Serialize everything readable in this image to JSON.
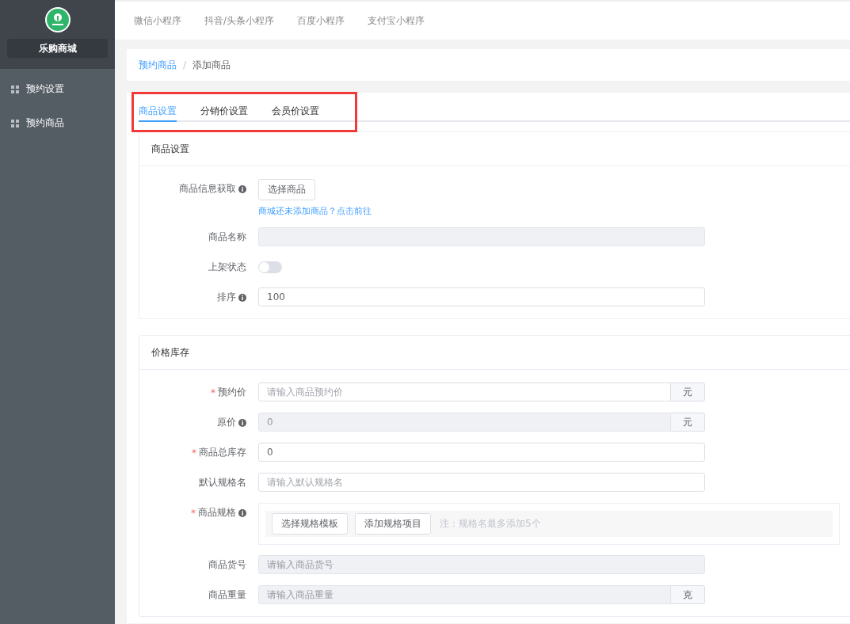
{
  "sidebar": {
    "shop_name": "乐购商城",
    "items": [
      {
        "label": "预约设置",
        "selected": false
      },
      {
        "label": "预约商品",
        "selected": false
      }
    ]
  },
  "top_tabs": [
    {
      "label": "微信小程序"
    },
    {
      "label": "抖音/头条小程序"
    },
    {
      "label": "百度小程序"
    },
    {
      "label": "支付宝小程序"
    }
  ],
  "breadcrumb": [
    {
      "label": "预约商品",
      "kind": "link"
    },
    {
      "label": "添加商品",
      "kind": "current"
    }
  ],
  "breadcrumb_separator": "/",
  "tabs": [
    {
      "label": "商品设置",
      "selected": true
    },
    {
      "label": "分销价设置",
      "selected": false
    },
    {
      "label": "会员价设置",
      "selected": false
    }
  ],
  "sections": [
    {
      "title": "商品设置",
      "fields": [
        {
          "kind": "picker",
          "label": "商品信息获取",
          "info": true,
          "button": "选择商品",
          "link": "商城还未添加商品？点击前往"
        },
        {
          "kind": "input",
          "label": "商品名称",
          "info": false,
          "disabled": true
        },
        {
          "kind": "switch",
          "label": "上架状态",
          "info": false,
          "on": false
        },
        {
          "kind": "input",
          "label": "排序",
          "info": true,
          "disabled": false,
          "value": "100"
        }
      ]
    },
    {
      "title": "价格库存",
      "fields": [
        {
          "kind": "input",
          "label": "预约价",
          "info": false,
          "required_mark": "*",
          "disabled": false,
          "placeholder": "请输入商品预约价",
          "suffix": "元"
        },
        {
          "kind": "input",
          "label": "原价",
          "info": true,
          "disabled": true,
          "value": "0",
          "suffix": "元"
        },
        {
          "kind": "input",
          "label": "商品总库存",
          "info": false,
          "required_mark": "*",
          "disabled": false,
          "value": "0"
        },
        {
          "kind": "input",
          "label": "默认规格名",
          "info": false,
          "disabled": false,
          "placeholder": "请输入默认规格名"
        },
        {
          "kind": "spec",
          "label": "商品规格",
          "info": true,
          "required_mark": "*",
          "buttons": [
            "选择规格模板",
            "添加规格项目"
          ],
          "note": "注：规格名最多添加5个"
        },
        {
          "kind": "input",
          "label": "商品货号",
          "info": false,
          "disabled": true,
          "placeholder": "请输入商品货号"
        },
        {
          "kind": "input",
          "label": "商品重量",
          "info": false,
          "disabled": true,
          "placeholder": "请输入商品重量",
          "suffix": "克"
        }
      ]
    }
  ]
}
